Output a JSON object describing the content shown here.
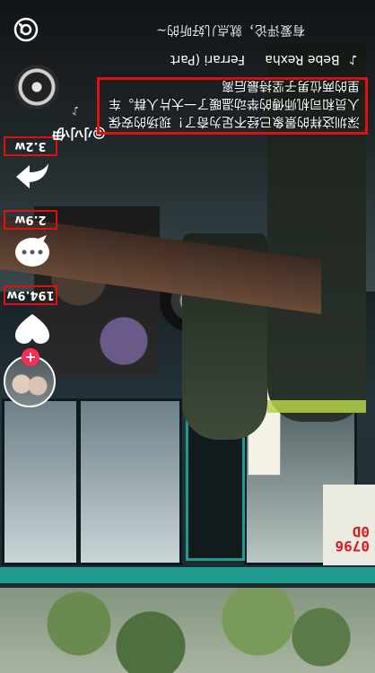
{
  "header": {
    "search_text": "有爱评论，就点儿好听的~",
    "icon_name": "at-mention-icon"
  },
  "video": {
    "route_number": "07960D"
  },
  "author": {
    "handle": "@小小伊"
  },
  "caption": {
    "text": "深圳这样的景象已经不足为奇了！现场的安保人员和司机师傅的举动温暖了一大片人群。车里的两位男子坚持最后离"
  },
  "music": {
    "title": "Ferrari (Part",
    "artist": "Bebe Rexha"
  },
  "actions": {
    "like_count": "194.9w",
    "comment_count": "2.9w",
    "share_count": "3.2w",
    "follow_symbol": "+",
    "like_icon": "heart-icon",
    "comment_icon": "comment-icon",
    "share_icon": "share-arrow-icon"
  },
  "colors": {
    "highlight_box": "#e01010",
    "follow_red": "#fe2c55",
    "bus_teal": "#1e9a8f"
  }
}
